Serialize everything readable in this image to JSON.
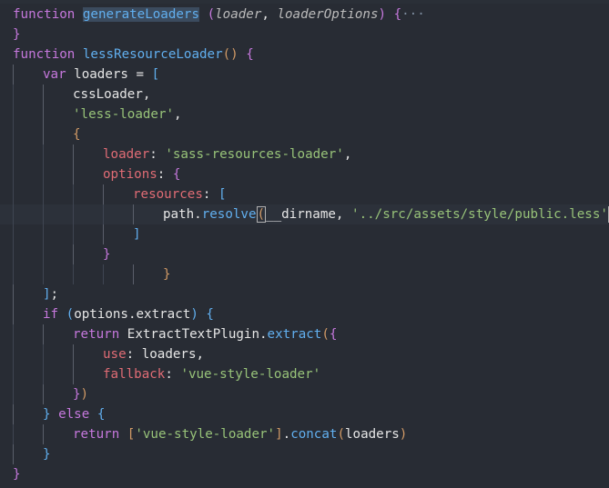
{
  "editor": {
    "language": "javascript",
    "colors": {
      "background": "#282c34",
      "keyword": "#c678dd",
      "function": "#61afef",
      "string": "#98c379",
      "property": "#e06c75",
      "class": "#e5c07b",
      "text": "#e6e6e6",
      "indent_guide": "#3f4552"
    },
    "lines": [
      {
        "tokens": [
          {
            "t": "function",
            "c": "kw"
          },
          {
            "t": " ",
            "c": "plain"
          },
          {
            "t": "generateLoaders",
            "c": "fn word-hl"
          },
          {
            "t": " ",
            "c": "plain"
          },
          {
            "t": "(",
            "c": "b2"
          },
          {
            "t": "loader",
            "c": "param"
          },
          {
            "t": ", ",
            "c": "plain"
          },
          {
            "t": "loaderOptions",
            "c": "param"
          },
          {
            "t": ")",
            "c": "b2"
          },
          {
            "t": " ",
            "c": "plain"
          },
          {
            "t": "{",
            "c": "b2"
          },
          {
            "t": "···",
            "c": "ellipsis"
          }
        ],
        "indent": 0
      },
      {
        "tokens": [
          {
            "t": "}",
            "c": "b2"
          }
        ],
        "indent": 0
      },
      {
        "tokens": [
          {
            "t": "function",
            "c": "kw"
          },
          {
            "t": " ",
            "c": "plain"
          },
          {
            "t": "lessResourceLoader",
            "c": "fn"
          },
          {
            "t": "()",
            "c": "b1"
          },
          {
            "t": " ",
            "c": "plain"
          },
          {
            "t": "{",
            "c": "b2"
          }
        ],
        "indent": 0
      },
      {
        "tokens": [
          {
            "t": "var",
            "c": "kw"
          },
          {
            "t": " loaders = ",
            "c": "plain"
          },
          {
            "t": "[",
            "c": "b3"
          }
        ],
        "indent": 1
      },
      {
        "tokens": [
          {
            "t": "cssLoader,",
            "c": "plain"
          }
        ],
        "indent": 2
      },
      {
        "tokens": [
          {
            "t": "'less-loader'",
            "c": "str"
          },
          {
            "t": ",",
            "c": "plain"
          }
        ],
        "indent": 2
      },
      {
        "tokens": [
          {
            "t": "{",
            "c": "b1"
          }
        ],
        "indent": 2
      },
      {
        "tokens": [
          {
            "t": "loader",
            "c": "prop"
          },
          {
            "t": ": ",
            "c": "plain"
          },
          {
            "t": "'sass-resources-loader'",
            "c": "str"
          },
          {
            "t": ",",
            "c": "plain"
          }
        ],
        "indent": 3
      },
      {
        "tokens": [
          {
            "t": "options",
            "c": "prop"
          },
          {
            "t": ": ",
            "c": "plain"
          },
          {
            "t": "{",
            "c": "b2"
          }
        ],
        "indent": 3
      },
      {
        "tokens": [
          {
            "t": "resources",
            "c": "prop"
          },
          {
            "t": ": ",
            "c": "plain"
          },
          {
            "t": "[",
            "c": "b3"
          }
        ],
        "indent": 4
      },
      {
        "tokens": [
          {
            "t": "path.",
            "c": "plain"
          },
          {
            "t": "resolve",
            "c": "fn"
          },
          {
            "t": "(",
            "c": "b1 bm"
          },
          {
            "t": "__dirname, ",
            "c": "plain"
          },
          {
            "t": "'../src/assets/style/public.less'",
            "c": "str"
          },
          {
            "t": ")",
            "c": "b1 bm"
          },
          {
            "t": ",",
            "c": "plain"
          }
        ],
        "indent": 5,
        "highlight": true
      },
      {
        "tokens": [
          {
            "t": "]",
            "c": "b3"
          }
        ],
        "indent": 4
      },
      {
        "tokens": [
          {
            "t": "}",
            "c": "b2"
          }
        ],
        "indent": 3
      },
      {
        "tokens": [
          {
            "t": "}",
            "c": "b1"
          }
        ],
        "indent": 5
      },
      {
        "tokens": [
          {
            "t": "]",
            "c": "b3"
          },
          {
            "t": ";",
            "c": "plain"
          }
        ],
        "indent": 1
      },
      {
        "tokens": [
          {
            "t": "if",
            "c": "kw"
          },
          {
            "t": " ",
            "c": "plain"
          },
          {
            "t": "(",
            "c": "b3"
          },
          {
            "t": "options.extract",
            "c": "plain"
          },
          {
            "t": ")",
            "c": "b3"
          },
          {
            "t": " ",
            "c": "plain"
          },
          {
            "t": "{",
            "c": "b3"
          }
        ],
        "indent": 1
      },
      {
        "tokens": [
          {
            "t": "return",
            "c": "kw"
          },
          {
            "t": " ExtractTextPlugin.",
            "c": "plain"
          },
          {
            "t": "extract",
            "c": "fn"
          },
          {
            "t": "(",
            "c": "b1"
          },
          {
            "t": "{",
            "c": "b2"
          }
        ],
        "indent": 2
      },
      {
        "tokens": [
          {
            "t": "use",
            "c": "prop"
          },
          {
            "t": ": loaders,",
            "c": "plain"
          }
        ],
        "indent": 3
      },
      {
        "tokens": [
          {
            "t": "fallback",
            "c": "prop"
          },
          {
            "t": ": ",
            "c": "plain"
          },
          {
            "t": "'vue-style-loader'",
            "c": "str"
          }
        ],
        "indent": 3
      },
      {
        "tokens": [
          {
            "t": "}",
            "c": "b2"
          },
          {
            "t": ")",
            "c": "b1"
          }
        ],
        "indent": 2
      },
      {
        "tokens": [
          {
            "t": "}",
            "c": "b3"
          },
          {
            "t": " ",
            "c": "plain"
          },
          {
            "t": "else",
            "c": "kw"
          },
          {
            "t": " ",
            "c": "plain"
          },
          {
            "t": "{",
            "c": "b3"
          }
        ],
        "indent": 1
      },
      {
        "tokens": [
          {
            "t": "return",
            "c": "kw"
          },
          {
            "t": " ",
            "c": "plain"
          },
          {
            "t": "[",
            "c": "b1"
          },
          {
            "t": "'vue-style-loader'",
            "c": "str"
          },
          {
            "t": "]",
            "c": "b1"
          },
          {
            "t": ".",
            "c": "plain"
          },
          {
            "t": "concat",
            "c": "fn"
          },
          {
            "t": "(",
            "c": "b1"
          },
          {
            "t": "loaders",
            "c": "plain"
          },
          {
            "t": ")",
            "c": "b1"
          }
        ],
        "indent": 2
      },
      {
        "tokens": [
          {
            "t": "}",
            "c": "b3"
          }
        ],
        "indent": 1
      },
      {
        "tokens": [
          {
            "t": "}",
            "c": "b2"
          }
        ],
        "indent": 0
      }
    ]
  }
}
